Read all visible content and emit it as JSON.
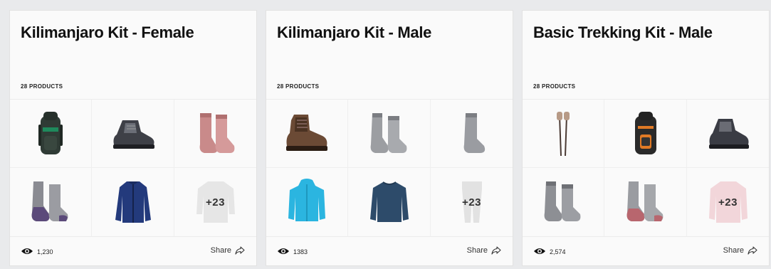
{
  "cards": [
    {
      "title": "Kilimanjaro Kit - Female",
      "products_count": "28 PRODUCTS",
      "products": [
        {
          "icon": "backpack-icon",
          "color": "#2f3b35",
          "accent": "#1f8a5c"
        },
        {
          "icon": "hiking-shoe-icon",
          "color": "#3e4047",
          "accent": "#6b6e77"
        },
        {
          "icon": "socks-icon",
          "color": "#c98a8a",
          "accent": "#b07070"
        },
        {
          "icon": "socks-icon",
          "color": "#8a8b92",
          "accent": "#5b4a7a"
        },
        {
          "icon": "jacket-icon",
          "color": "#233a7c",
          "accent": "#1a2c60"
        },
        {
          "icon": "base-layer-icon",
          "color": "#e6e6e6",
          "accent": "#dcdcdc"
        }
      ],
      "more_label": "+23",
      "views": "1,230",
      "share_label": "Share"
    },
    {
      "title": "Kilimanjaro Kit - Male",
      "products_count": "28 PRODUCTS",
      "products": [
        {
          "icon": "hiking-boot-icon",
          "color": "#6b4a35",
          "accent": "#4a3222"
        },
        {
          "icon": "socks-icon",
          "color": "#9c9ea2",
          "accent": "#7b7d82"
        },
        {
          "icon": "sock-icon",
          "color": "#9a9ca1",
          "accent": "#7c7e83"
        },
        {
          "icon": "rain-jacket-icon",
          "color": "#2bb5e0",
          "accent": "#1b8fb4"
        },
        {
          "icon": "long-sleeve-shirt-icon",
          "color": "#2d4b6a",
          "accent": "#223a52"
        },
        {
          "icon": "tights-icon",
          "color": "#e2e2e2",
          "accent": "#d8d8d8"
        }
      ],
      "more_label": "+23",
      "views": "1383",
      "share_label": "Share"
    },
    {
      "title": "Basic Trekking Kit - Male",
      "products_count": "28 PRODUCTS",
      "products": [
        {
          "icon": "trekking-poles-icon",
          "color": "#4a3a33",
          "accent": "#b79a86"
        },
        {
          "icon": "backpack-icon",
          "color": "#2a2a2a",
          "accent": "#e07a25"
        },
        {
          "icon": "hiking-shoe-icon",
          "color": "#3a3c44",
          "accent": "#6a6c74"
        },
        {
          "icon": "socks-icon",
          "color": "#8d8f94",
          "accent": "#6e7075"
        },
        {
          "icon": "socks-icon",
          "color": "#9a9ca1",
          "accent": "#b8666e"
        },
        {
          "icon": "jacket-icon",
          "color": "#f2d6da",
          "accent": "#e9c3c9"
        }
      ],
      "more_label": "+23",
      "views": "2,574",
      "share_label": "Share"
    }
  ]
}
